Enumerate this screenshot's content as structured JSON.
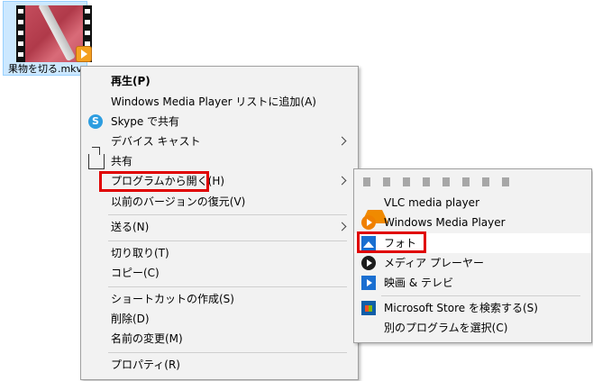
{
  "file": {
    "name": "果物を切る.mkv",
    "icon": "video-file-icon"
  },
  "context_menu": {
    "items": [
      {
        "label": "再生(P)"
      },
      {
        "label": "Windows Media Player リストに追加(A)"
      },
      {
        "label": "Skype で共有",
        "icon": "skype-icon"
      },
      {
        "label": "デバイス キャスト"
      },
      {
        "label": "共有",
        "icon": "share-icon"
      },
      {
        "label": "プログラムから開く(H)"
      },
      {
        "label": "以前のバージョンの復元(V)"
      },
      {
        "label": "送る(N)"
      },
      {
        "label": "切り取り(T)"
      },
      {
        "label": "コピー(C)"
      },
      {
        "label": "ショートカットの作成(S)"
      },
      {
        "label": "削除(D)"
      },
      {
        "label": "名前の変更(M)"
      },
      {
        "label": "プロパティ(R)"
      }
    ]
  },
  "submenu": {
    "items": [
      {
        "label": "VLC media player",
        "icon": "vlc-icon"
      },
      {
        "label": "Windows Media Player",
        "icon": "windows-media-player-icon"
      },
      {
        "label": "フォト",
        "icon": "photos-icon"
      },
      {
        "label": "メディア プレーヤー",
        "icon": "media-player-icon"
      },
      {
        "label": "映画 & テレビ",
        "icon": "movies-tv-icon"
      },
      {
        "label": "Microsoft Store を検索する(S)",
        "icon": "store-icon"
      },
      {
        "label": "別のプログラムを選択(C)"
      }
    ]
  },
  "colors": {
    "highlight_border": "#e00000",
    "menu_bg": "#f2f2f2",
    "selection": "#cce8ff"
  }
}
